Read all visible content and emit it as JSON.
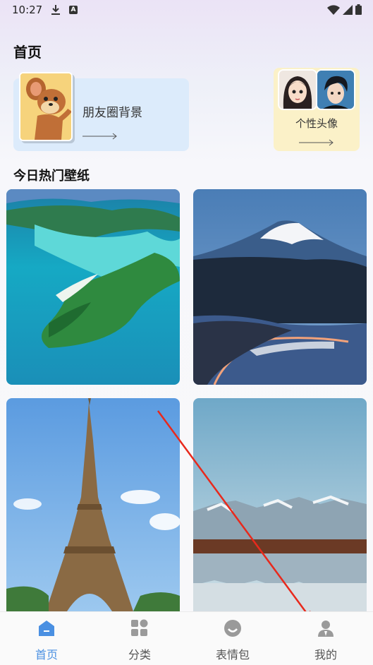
{
  "status_bar": {
    "time": "10:27"
  },
  "page": {
    "title": "首页"
  },
  "cards": {
    "moments": {
      "label": "朋友圈背景"
    },
    "avatar": {
      "label": "个性头像"
    }
  },
  "section": {
    "title": "今日热门壁纸"
  },
  "wallpapers": [
    {
      "name": "tropical-island"
    },
    {
      "name": "mount-fuji"
    },
    {
      "name": "eiffel-tower"
    },
    {
      "name": "mountain-lake-reflection"
    }
  ],
  "tabbar": {
    "items": [
      {
        "label": "首页",
        "icon": "home-icon",
        "active": true
      },
      {
        "label": "分类",
        "icon": "grid-icon",
        "active": false
      },
      {
        "label": "表情包",
        "icon": "smile-icon",
        "active": false
      },
      {
        "label": "我的",
        "icon": "user-icon",
        "active": false
      }
    ]
  },
  "colors": {
    "accent": "#4a90e2",
    "annotation_arrow": "#e8291c"
  }
}
